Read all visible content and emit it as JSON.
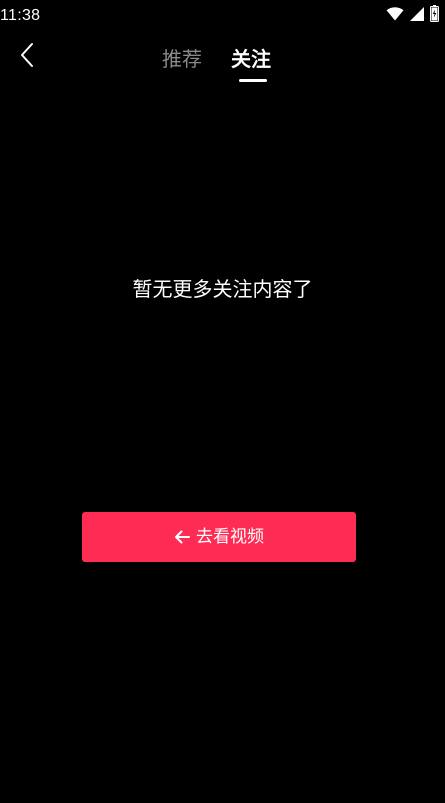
{
  "status_bar": {
    "time": "11:38",
    "icons": [
      "wifi-icon",
      "cellular-signal-icon",
      "battery-icon"
    ]
  },
  "header": {
    "back_icon": "chevron-left-icon",
    "tabs": [
      {
        "label": "推荐",
        "active": false
      },
      {
        "label": "关注",
        "active": true
      }
    ]
  },
  "main": {
    "empty_message": "暂无更多关注内容了",
    "cta": {
      "icon": "arrow-left-icon",
      "label": "去看视频"
    }
  },
  "colors": {
    "background": "#000000",
    "text_primary": "#ffffff",
    "text_inactive": "#8a8a8a",
    "accent": "#fe2c55"
  }
}
